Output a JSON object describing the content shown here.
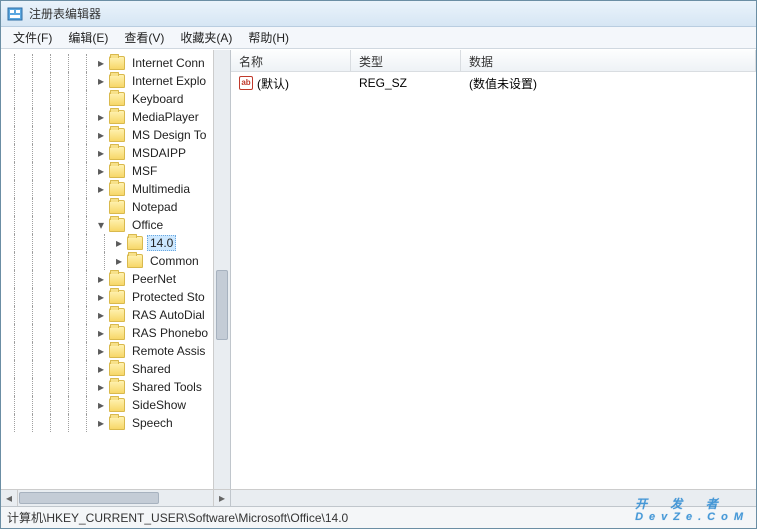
{
  "window": {
    "title": "注册表编辑器"
  },
  "menu": {
    "file": "文件(F)",
    "edit": "编辑(E)",
    "view": "查看(V)",
    "favorites": "收藏夹(A)",
    "help": "帮助(H)"
  },
  "tree": {
    "items": [
      {
        "label": "Internet Conn",
        "depth": 5,
        "twisty": "closed"
      },
      {
        "label": "Internet Explo",
        "depth": 5,
        "twisty": "closed"
      },
      {
        "label": "Keyboard",
        "depth": 5,
        "twisty": "none"
      },
      {
        "label": "MediaPlayer",
        "depth": 5,
        "twisty": "closed"
      },
      {
        "label": "MS Design To",
        "depth": 5,
        "twisty": "closed"
      },
      {
        "label": "MSDAIPP",
        "depth": 5,
        "twisty": "closed"
      },
      {
        "label": "MSF",
        "depth": 5,
        "twisty": "closed"
      },
      {
        "label": "Multimedia",
        "depth": 5,
        "twisty": "closed"
      },
      {
        "label": "Notepad",
        "depth": 5,
        "twisty": "none"
      },
      {
        "label": "Office",
        "depth": 5,
        "twisty": "open"
      },
      {
        "label": "14.0",
        "depth": 6,
        "twisty": "closed",
        "selected": true
      },
      {
        "label": "Common",
        "depth": 6,
        "twisty": "closed"
      },
      {
        "label": "PeerNet",
        "depth": 5,
        "twisty": "closed"
      },
      {
        "label": "Protected Sto",
        "depth": 5,
        "twisty": "closed"
      },
      {
        "label": "RAS AutoDial",
        "depth": 5,
        "twisty": "closed"
      },
      {
        "label": "RAS Phonebo",
        "depth": 5,
        "twisty": "closed"
      },
      {
        "label": "Remote Assis",
        "depth": 5,
        "twisty": "closed"
      },
      {
        "label": "Shared",
        "depth": 5,
        "twisty": "closed"
      },
      {
        "label": "Shared Tools",
        "depth": 5,
        "twisty": "closed"
      },
      {
        "label": "SideShow",
        "depth": 5,
        "twisty": "closed"
      },
      {
        "label": "Speech",
        "depth": 5,
        "twisty": "closed"
      }
    ]
  },
  "list": {
    "headers": {
      "name": "名称",
      "type": "类型",
      "data": "数据"
    },
    "rows": [
      {
        "name": "(默认)",
        "type": "REG_SZ",
        "data": "(数值未设置)"
      }
    ]
  },
  "status": {
    "path": "计算机\\HKEY_CURRENT_USER\\Software\\Microsoft\\Office\\14.0"
  },
  "watermark": {
    "chars": "开 发 者",
    "sub": "DevZe.CoM"
  }
}
